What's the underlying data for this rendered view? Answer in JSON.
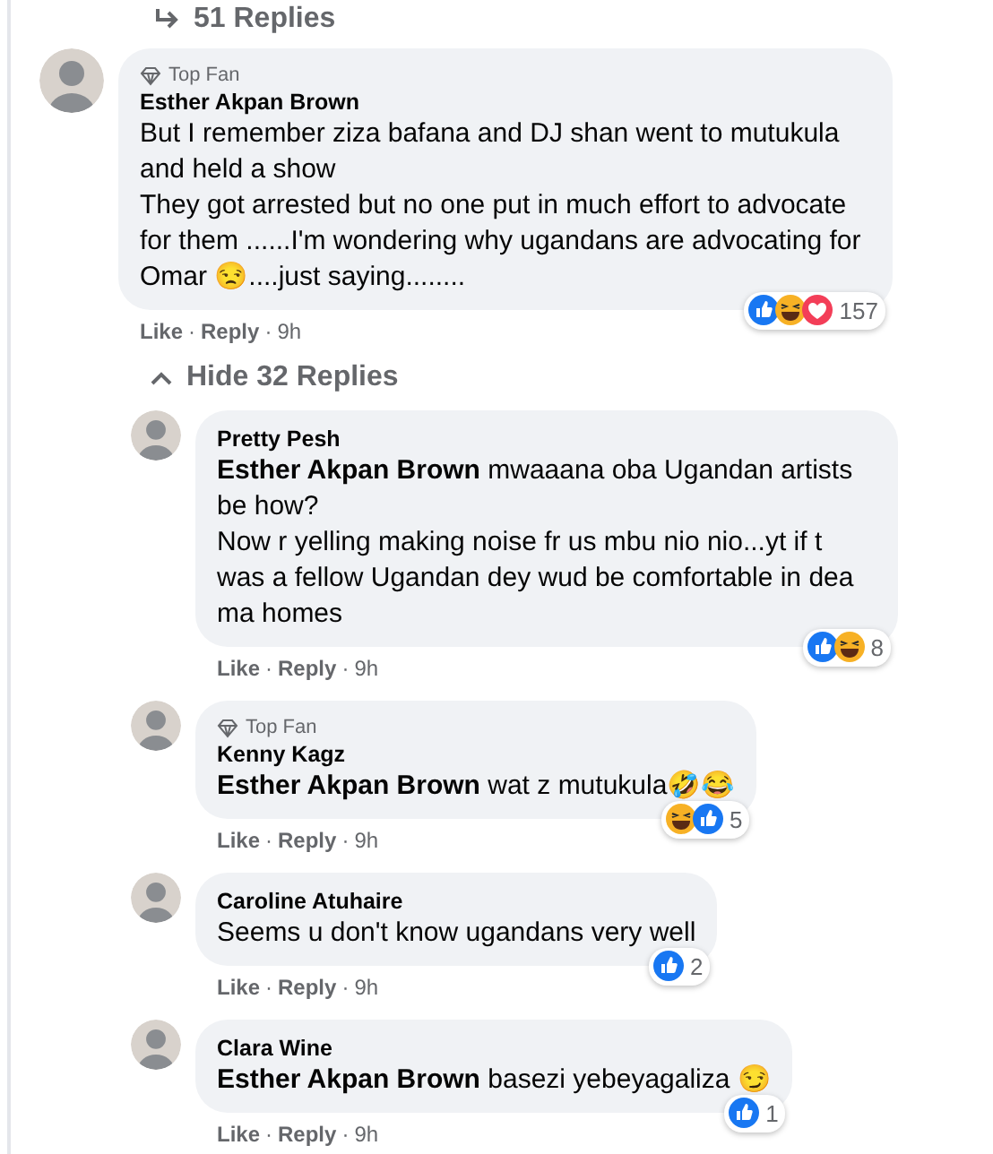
{
  "replies_link": {
    "label": "51 Replies"
  },
  "separator": "·",
  "comment": {
    "author": "Esther Akpan Brown",
    "badge": "Top Fan",
    "text": "But I remember ziza bafana and DJ shan went to mutukula and held a show\nThey got arrested but no one put in much effort to advocate for them ......I'm wondering why ugandans are advocating for Omar 😒....just saying........",
    "actions": {
      "like": "Like",
      "reply": "Reply",
      "time": "9h"
    },
    "reactions": {
      "items": [
        {
          "kind": "like"
        },
        {
          "kind": "haha"
        },
        {
          "kind": "love"
        }
      ],
      "count": "157"
    }
  },
  "hide_replies": {
    "label": "Hide 32 Replies"
  },
  "replies": [
    {
      "author": "Pretty Pesh",
      "text": "**Esther Akpan Brown** mwaaana oba Ugandan artists be how?\nNow r yelling making noise fr us mbu nio nio...yt if t was a fellow Ugandan dey wud be comfortable in dea ma homes",
      "actions": {
        "like": "Like",
        "reply": "Reply",
        "time": "9h"
      },
      "reactions": {
        "items": [
          {
            "kind": "like"
          },
          {
            "kind": "haha"
          }
        ],
        "count": "8"
      }
    },
    {
      "author": "Kenny Kagz",
      "badge": "Top Fan",
      "text": "**Esther Akpan Brown** wat z mutukula🤣😂",
      "actions": {
        "like": "Like",
        "reply": "Reply",
        "time": "9h"
      },
      "reactions": {
        "items": [
          {
            "kind": "haha"
          },
          {
            "kind": "like"
          }
        ],
        "count": "5"
      }
    },
    {
      "author": "Caroline Atuhaire",
      "text": "Seems u don't know ugandans very well",
      "actions": {
        "like": "Like",
        "reply": "Reply",
        "time": "9h"
      },
      "reactions": {
        "items": [
          {
            "kind": "like"
          }
        ],
        "count": "2"
      }
    },
    {
      "author": "Clara Wine",
      "text": "**Esther Akpan Brown** basezi yebeyagaliza 😏",
      "actions": {
        "like": "Like",
        "reply": "Reply",
        "time": "9h"
      },
      "reactions": {
        "items": [
          {
            "kind": "like"
          }
        ],
        "count": "1"
      }
    }
  ]
}
